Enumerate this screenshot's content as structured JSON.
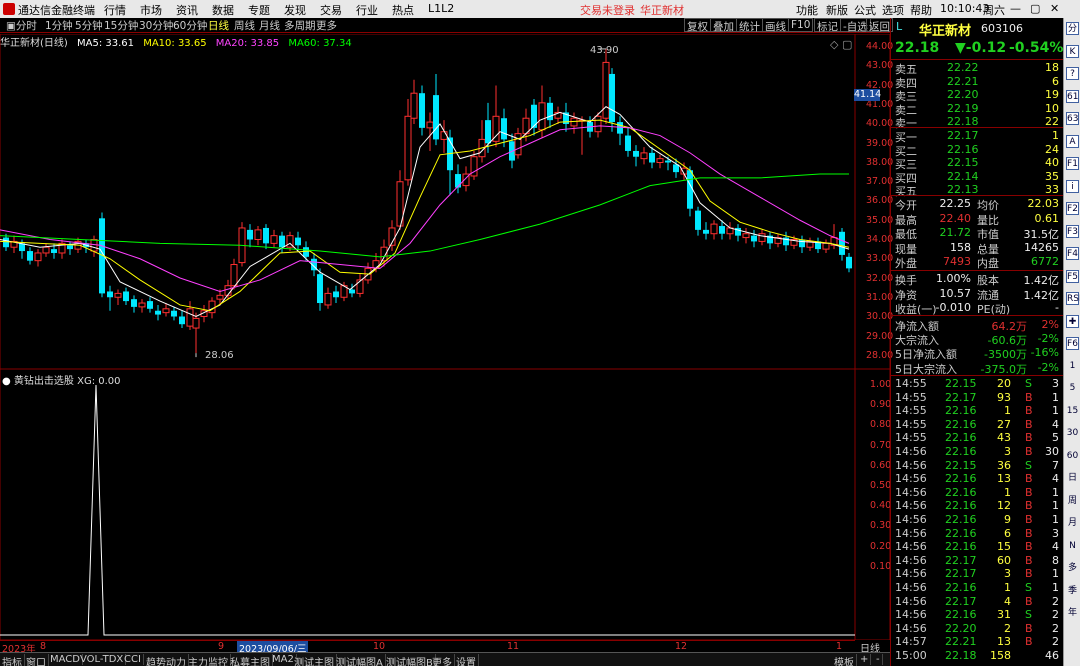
{
  "titlebar": {
    "app_name": "通达信金融终端",
    "menus": [
      "行情",
      "市场",
      "资讯",
      "数据",
      "专题",
      "发现",
      "交易",
      "行业",
      "热点",
      "L1L2"
    ],
    "notice_1": "交易未登录",
    "notice_2": "华正新材",
    "right_menus": [
      "功能",
      "新版",
      "公式",
      "选项",
      "帮助"
    ],
    "time": "10:10:43",
    "weekday": "周六"
  },
  "toolbar": {
    "periods": [
      "分时",
      "1分钟",
      "5分钟",
      "15分钟",
      "30分钟",
      "60分钟",
      "日线",
      "周线",
      "月线",
      "多周期",
      "更多"
    ],
    "active_period": "日线",
    "buttons": [
      "复权",
      "叠加",
      "统计",
      "画线",
      "F10",
      "标记",
      "-自选",
      "返回"
    ]
  },
  "chart": {
    "stock_label": "华正新材(日线)",
    "ma5": "MA5: 33.61",
    "ma10": "MA10: 33.65",
    "ma20": "MA20: 33.85",
    "ma60": "MA60: 37.34",
    "high_label": "43.90",
    "low_label": "28.06",
    "cursor_price": "41.14",
    "price_ticks": [
      "44.00",
      "43.00",
      "42.00",
      "41.00",
      "40.00",
      "39.00",
      "38.00",
      "37.00",
      "36.00",
      "35.00",
      "34.00",
      "33.00",
      "32.00",
      "31.00",
      "30.00",
      "29.00",
      "28.00"
    ],
    "indicator_label": "黄钻出击选股 XG: 0.00",
    "indicator_ticks": [
      "1.00",
      "0.90",
      "0.80",
      "0.70",
      "0.60",
      "0.50",
      "0.40",
      "0.30",
      "0.20",
      "0.10"
    ],
    "dates": [
      "2023年",
      "8",
      "9",
      "2023/09/06/三",
      "10",
      "11",
      "12",
      "1"
    ],
    "colors": {
      "up": "#ff3030",
      "down": "#00e8ff",
      "ma5": "#ffffff",
      "ma10": "#ffff00",
      "ma20": "#ff40ff",
      "ma60": "#00ff00"
    }
  },
  "bottom_tabs": [
    "指标",
    "窗口",
    "MACD",
    "VOL-TDX",
    "CCI",
    "趋势动力",
    "主力监控",
    "私募主图",
    "MA2",
    "测试主图",
    "测试幅图A",
    "测试幅图B",
    "更多",
    "设置"
  ],
  "bottom_right": [
    "模板",
    "+",
    "-"
  ],
  "datebar_right": "日线",
  "quote": {
    "tag": "L",
    "name": "华正新材",
    "code": "603106",
    "price": "22.18",
    "change": "▼-0.12",
    "pct": "-0.54%",
    "asks": [
      [
        "卖五",
        "22.22",
        "18"
      ],
      [
        "卖四",
        "22.21",
        "6"
      ],
      [
        "卖三",
        "22.20",
        "19"
      ],
      [
        "卖二",
        "22.19",
        "10"
      ],
      [
        "卖一",
        "22.18",
        "22"
      ]
    ],
    "bids": [
      [
        "买一",
        "22.17",
        "1"
      ],
      [
        "买二",
        "22.16",
        "24"
      ],
      [
        "买三",
        "22.15",
        "40"
      ],
      [
        "买四",
        "22.14",
        "35"
      ],
      [
        "买五",
        "22.13",
        "33"
      ]
    ],
    "stats": [
      [
        "今开",
        "22.25",
        "均价",
        "22.03"
      ],
      [
        "最高",
        "22.40",
        "量比",
        "0.61"
      ],
      [
        "最低",
        "21.72",
        "市值",
        "31.5亿"
      ],
      [
        "现量",
        "158",
        "总量",
        "14265"
      ],
      [
        "外盘",
        "7493",
        "内盘",
        "6772"
      ]
    ],
    "stats2": [
      [
        "换手",
        "1.00%",
        "股本",
        "1.42亿"
      ],
      [
        "净资",
        "10.57",
        "流通",
        "1.42亿"
      ],
      [
        "收益(一)",
        "-0.010",
        "PE(动)",
        "-"
      ]
    ],
    "flows": [
      [
        "净流入额",
        "64.2万",
        "2%"
      ],
      [
        "大宗流入",
        "-60.6万",
        "-2%"
      ],
      [
        "5日净流入额",
        "-3500万",
        "-16%"
      ],
      [
        "5日大宗流入",
        "-375.0万",
        "-2%"
      ]
    ],
    "ticks": [
      [
        "14:55",
        "22.15",
        "20",
        "S",
        "3"
      ],
      [
        "14:55",
        "22.17",
        "93",
        "B",
        "1"
      ],
      [
        "14:55",
        "22.16",
        "1",
        "B",
        "1"
      ],
      [
        "14:55",
        "22.16",
        "27",
        "B",
        "4"
      ],
      [
        "14:55",
        "22.16",
        "43",
        "B",
        "5"
      ],
      [
        "14:56",
        "22.16",
        "3",
        "B",
        "30"
      ],
      [
        "14:56",
        "22.15",
        "36",
        "S",
        "7"
      ],
      [
        "14:56",
        "22.16",
        "13",
        "B",
        "4"
      ],
      [
        "14:56",
        "22.16",
        "1",
        "B",
        "1"
      ],
      [
        "14:56",
        "22.16",
        "12",
        "B",
        "1"
      ],
      [
        "14:56",
        "22.16",
        "9",
        "B",
        "1"
      ],
      [
        "14:56",
        "22.16",
        "6",
        "B",
        "3"
      ],
      [
        "14:56",
        "22.16",
        "15",
        "B",
        "4"
      ],
      [
        "14:56",
        "22.17",
        "60",
        "B",
        "8"
      ],
      [
        "14:56",
        "22.17",
        "3",
        "B",
        "1"
      ],
      [
        "14:56",
        "22.16",
        "1",
        "S",
        "1"
      ],
      [
        "14:56",
        "22.17",
        "4",
        "B",
        "2"
      ],
      [
        "14:56",
        "22.16",
        "31",
        "S",
        "2"
      ],
      [
        "14:56",
        "22.20",
        "2",
        "B",
        "2"
      ],
      [
        "14:57",
        "22.21",
        "13",
        "B",
        "2"
      ],
      [
        "15:00",
        "22.18",
        "158",
        "",
        "46"
      ]
    ]
  },
  "sidebar_icons": [
    "分",
    "K",
    "?",
    "61",
    "63",
    "A",
    "F1",
    "i",
    "F2",
    "F3",
    "F4",
    "F5",
    "RSI",
    "✚",
    "F6",
    "1",
    "5",
    "15",
    "30",
    "60",
    "日",
    "周",
    "月",
    "N",
    "多",
    "季",
    "年"
  ]
}
